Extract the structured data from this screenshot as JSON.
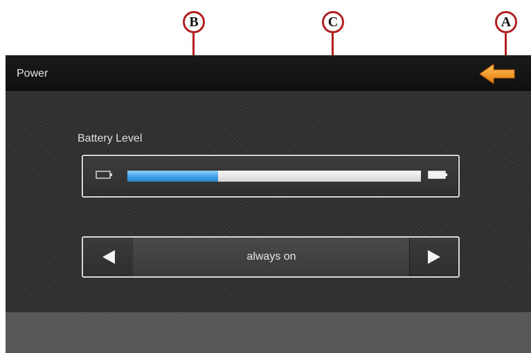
{
  "screen": {
    "title": "Power",
    "back_icon": "arrow-left-icon",
    "colors": {
      "background": "#2a2a2a",
      "titlebar": "#111111",
      "back_arrow": "#f0901e",
      "battery_fill": "#3a9fe6",
      "bottom_bar": "#585858"
    }
  },
  "battery": {
    "label": "Battery Level",
    "level": 0.31,
    "empty_icon": "battery-empty-icon",
    "full_icon": "battery-full-icon"
  },
  "mode_selector": {
    "value": "always on",
    "prev_icon": "triangle-left-icon",
    "next_icon": "triangle-right-icon"
  },
  "callouts": {
    "a": "A",
    "b": "B",
    "c": "C",
    "color": "#b21f1f"
  }
}
